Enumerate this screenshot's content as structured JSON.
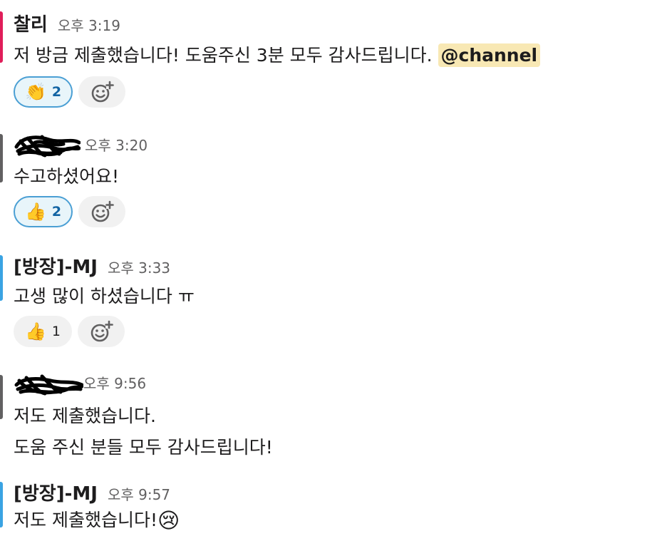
{
  "messages": [
    {
      "author": "찰리",
      "time": "오후 3:19",
      "lines": [
        "저 방금 제출했습니다! 도움주신 3분 모두 감사드립니다. "
      ],
      "mention": "@channel",
      "reactions": [
        {
          "emoji": "👏",
          "count": "2",
          "active": true
        }
      ]
    },
    {
      "author": "",
      "time": "오후 3:20",
      "lines": [
        "수고하셨어요!"
      ],
      "reactions": [
        {
          "emoji": "👍",
          "count": "2",
          "active": true
        }
      ]
    },
    {
      "author": "[방장]-MJ",
      "time": "오후 3:33",
      "lines": [
        "고생 많이 하셨습니다 ㅠ"
      ],
      "reactions": [
        {
          "emoji": "👍",
          "count": "1",
          "active": false
        }
      ]
    },
    {
      "author": "",
      "time": "오후 9:56",
      "lines": [
        "저도 제출했습니다.",
        "도움 주신 분들 모두 감사드립니다!"
      ]
    },
    {
      "author": "[방장]-MJ",
      "time": "오후 9:57",
      "lines": [
        "저도 제출했습니다!"
      ],
      "inline_emoji": "😢"
    }
  ],
  "colors": {
    "avatar_1": "#e01e5a",
    "avatar_other": "#616061",
    "mention_bg": "#f8e8b4",
    "reaction_active_border": "#4a9fd4",
    "reaction_active_bg": "#e8f5fa"
  },
  "icons": {
    "add_reaction": "add-reaction-icon"
  }
}
